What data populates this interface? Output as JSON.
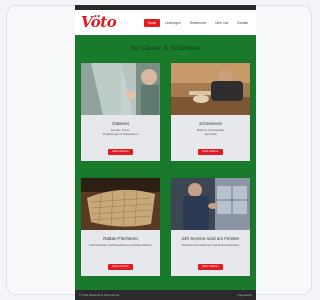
{
  "site": {
    "logo": "Vöto",
    "nav": [
      "Home",
      "Leistungen",
      "Referenzen",
      "Über uns",
      "Kontakt"
    ],
    "headline": "Ihr Glaser & Schreiner"
  },
  "services": [
    {
      "title": "Glaserei",
      "desc": "Fenster, Türen,\nVerglasungen & Reparaturen",
      "button": "Mehr erfahren"
    },
    {
      "title": "Schreinerei",
      "desc": "Möbel & Innenausbau\nnach Maß",
      "button": "Mehr erfahren"
    },
    {
      "title": "Rattan-Flechterei",
      "desc": "Flechtarbeiten und Reparaturen an Rattan-Möbeln",
      "button": "Mehr erfahren"
    },
    {
      "title": "24h Service rund um Fenster",
      "desc": "Notdienst bei Glasbruch und Einbruchschäden",
      "button": "Mehr erfahren"
    }
  ],
  "footer": {
    "left": "© Vöto Glaserei & Schreinerei",
    "right": "Impressum"
  },
  "colors": {
    "accent": "#e01b22",
    "brand_green": "#1a7a2c"
  }
}
